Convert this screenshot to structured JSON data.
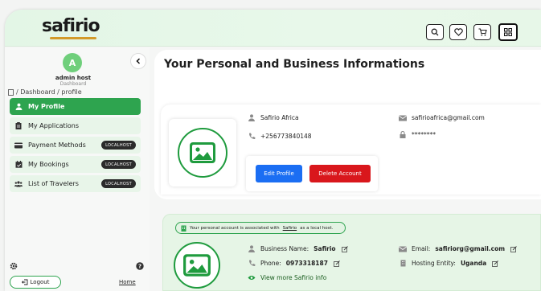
{
  "header": {
    "logo_text": "safirio",
    "buttons": [
      "search-icon",
      "heart-icon",
      "cart-icon",
      "grid-icon"
    ]
  },
  "sidebar": {
    "avatar_letter": "A",
    "user_name": "admin host",
    "user_role": "Dashboard",
    "breadcrumb": "/ Dashboard / profile",
    "items": [
      {
        "label": "My Profile",
        "icon": "user-icon",
        "active": true,
        "badge": ""
      },
      {
        "label": "My Applications",
        "icon": "clipboard-icon",
        "active": false,
        "badge": ""
      },
      {
        "label": "Payment Methods",
        "icon": "credit-card-icon",
        "active": false,
        "badge": "LOCALHOST"
      },
      {
        "label": "My Bookings",
        "icon": "calendar-icon",
        "active": false,
        "badge": "LOCALHOST"
      },
      {
        "label": "List of Travelers",
        "icon": "users-icon",
        "active": false,
        "badge": "LOCALHOST"
      }
    ],
    "logout_label": "Logout",
    "home_label": "Home"
  },
  "main": {
    "title": "Your Personal and Business Informations",
    "profile": {
      "name": "Safirio Africa",
      "phone": "+256773840148",
      "email": "safirioafrica@gmail.com",
      "password": "********",
      "edit_label": "Edit Profile",
      "delete_label": "Delete Account"
    },
    "business": {
      "notice_prefix": "Your personal account is associated with",
      "notice_link": "Safirio",
      "notice_suffix": "as a local host.",
      "name_label": "Business Name:",
      "name_value": "Safirio",
      "phone_label": "Phone:",
      "phone_value": "0973318187",
      "email_label": "Email:",
      "email_value": "safiriorg@gmail.com",
      "entity_label": "Hosting Entity:",
      "entity_value": "Uganda",
      "view_more": "View more Safirio info"
    }
  },
  "colors": {
    "accent": "#2ea44f",
    "edit": "#1b6ef3",
    "delete": "#d9171c"
  }
}
